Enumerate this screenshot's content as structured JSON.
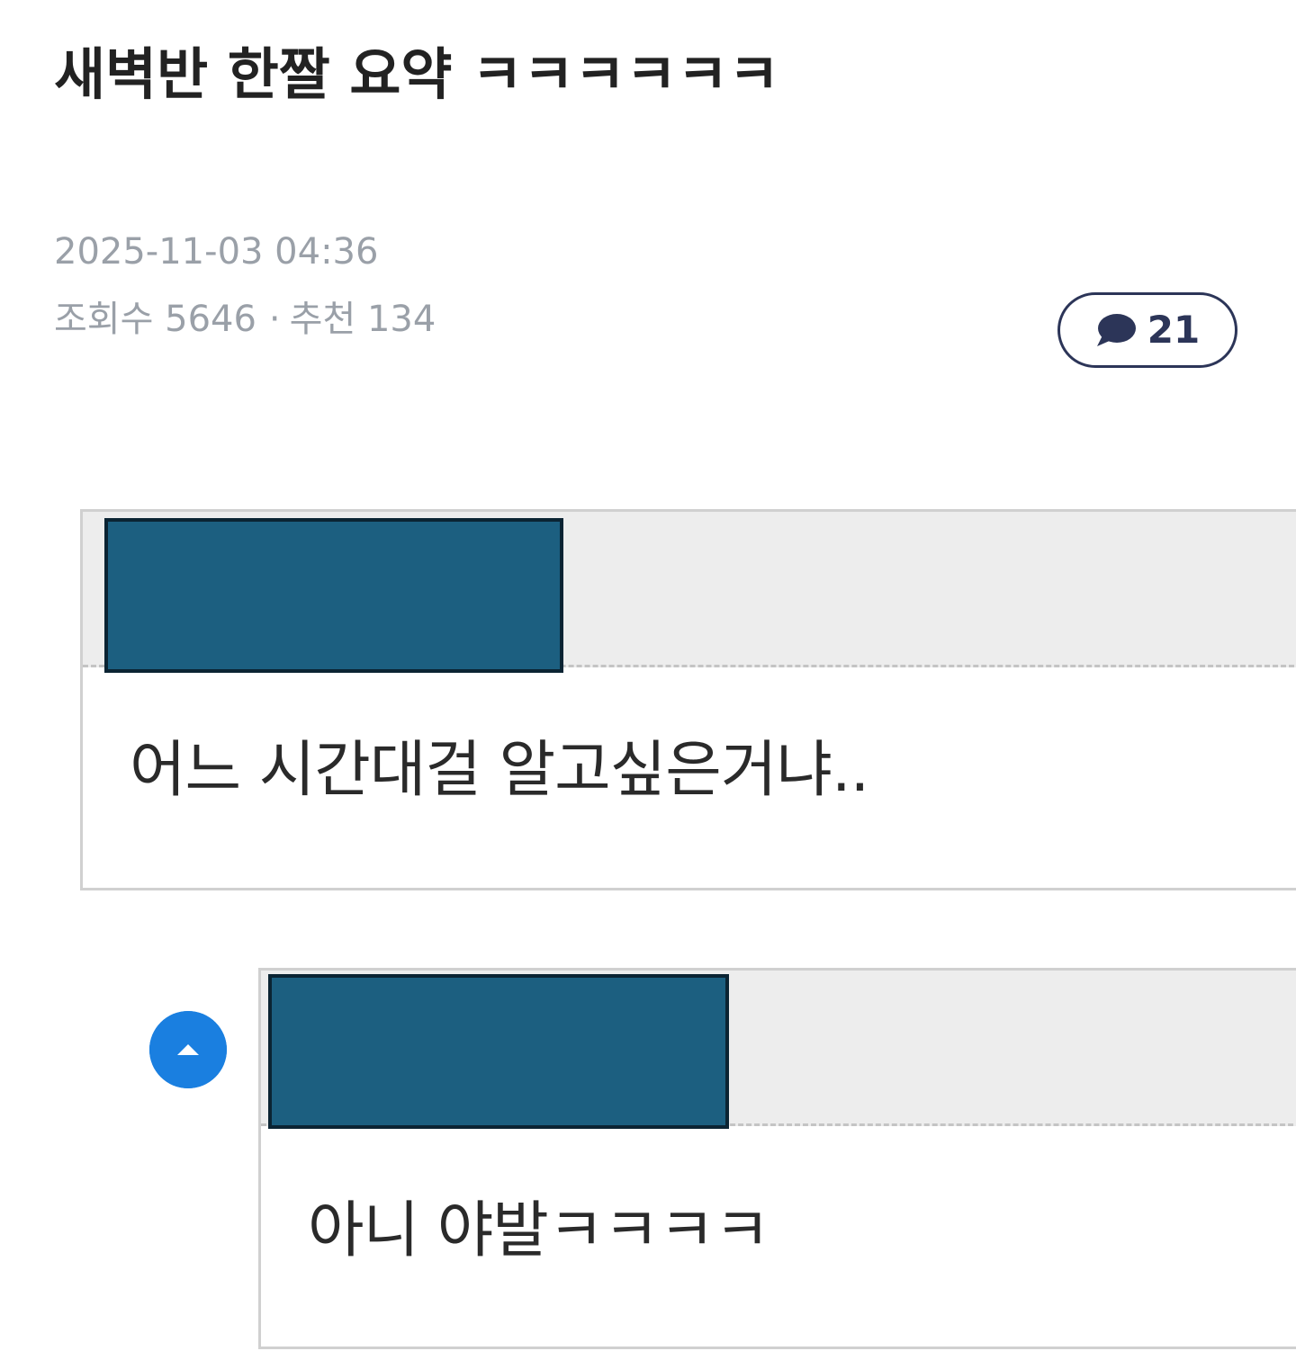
{
  "post": {
    "title": "새벽반 한짤 요약 ㅋㅋㅋㅋㅋㅋ",
    "date": "2025-11-03 04:36",
    "views_label": "조회수 5646",
    "separator": "·",
    "recommend_label": "추천 134",
    "comment_count": "21"
  },
  "image": {
    "comment_1": {
      "text": "어느 시간대걸 알고싶은거냐.."
    },
    "comment_2": {
      "text": "아니 야발ㅋㅋㅋㅋ"
    }
  },
  "colors": {
    "accent": "#2c3558",
    "meta_text": "#9aa0a8",
    "redaction": "#1c5f80",
    "reply_icon": "#1a7fe0"
  },
  "icons": {
    "comment": "speech-bubble-icon",
    "reply": "reply-up-arrow-icon"
  }
}
